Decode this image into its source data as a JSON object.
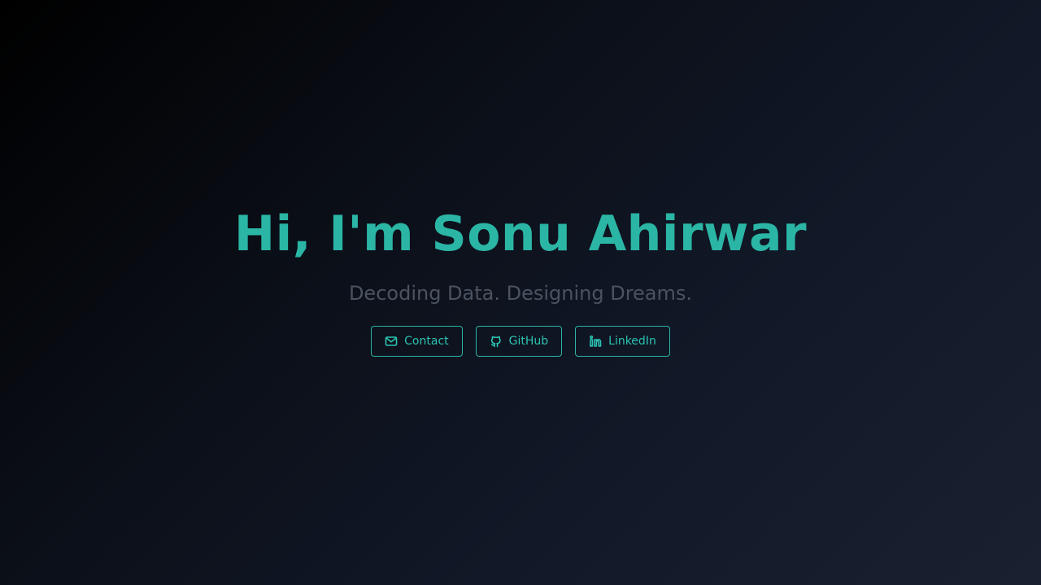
{
  "hero": {
    "title": "Hi, I'm Sonu Ahirwar",
    "subtitle": "Decoding Data. Designing Dreams."
  },
  "links": [
    {
      "label": "Contact",
      "icon": "mail-icon"
    },
    {
      "label": "GitHub",
      "icon": "github-icon"
    },
    {
      "label": "LinkedIn",
      "icon": "linkedin-icon"
    }
  ],
  "colors": {
    "accent": "#2bb5a5",
    "subtitle": "#4b5360",
    "background_start": "#000000",
    "background_end": "#1a2030"
  }
}
